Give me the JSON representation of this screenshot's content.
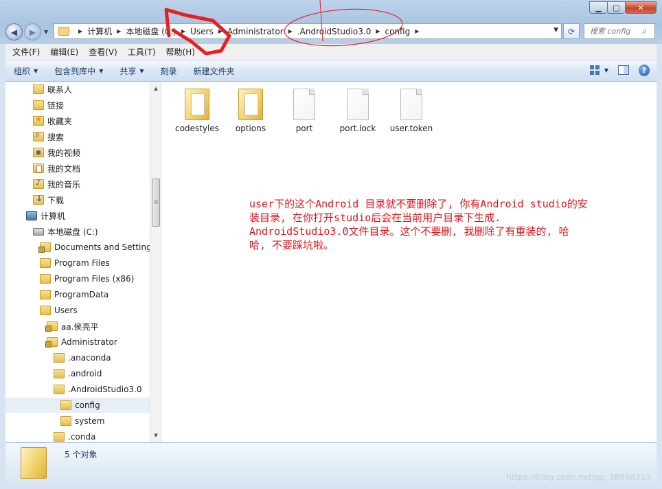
{
  "window": {
    "controls": {
      "minimize": "▁",
      "maximize": "□",
      "close": "✕"
    }
  },
  "nav": {
    "back_glyph": "◀",
    "forward_glyph": "▶"
  },
  "address": {
    "crumbs": [
      "计算机",
      "本地磁盘 (C:)",
      "Users",
      "Administrator",
      ".AndroidStudio3.0",
      "config"
    ]
  },
  "search": {
    "placeholder": "搜索 config"
  },
  "menu": [
    "文件(F)",
    "编辑(E)",
    "查看(V)",
    "工具(T)",
    "帮助(H)"
  ],
  "commands": {
    "organize": "组织",
    "include_in_library": "包含到库中",
    "share": "共享",
    "burn": "刻录",
    "new_folder": "新建文件夹"
  },
  "tree": [
    {
      "label": "联系人",
      "icon": "folder",
      "indent": 1
    },
    {
      "label": "链接",
      "icon": "folder",
      "indent": 1
    },
    {
      "label": "收藏夹",
      "icon": "star",
      "indent": 1
    },
    {
      "label": "搜索",
      "icon": "search",
      "indent": 1
    },
    {
      "label": "我的视频",
      "icon": "video",
      "indent": 1
    },
    {
      "label": "我的文档",
      "icon": "docs",
      "indent": 1
    },
    {
      "label": "我的音乐",
      "icon": "music",
      "indent": 1
    },
    {
      "label": "下载",
      "icon": "download",
      "indent": 1
    },
    {
      "label": "计算机",
      "icon": "computer",
      "indent": 0
    },
    {
      "label": "本地磁盘 (C:)",
      "icon": "drive",
      "indent": 1
    },
    {
      "label": "Documents and Settings",
      "icon": "folder-locked",
      "indent": 2
    },
    {
      "label": "Program Files",
      "icon": "folder",
      "indent": 2
    },
    {
      "label": "Program Files (x86)",
      "icon": "folder",
      "indent": 2
    },
    {
      "label": "ProgramData",
      "icon": "folder",
      "indent": 2
    },
    {
      "label": "Users",
      "icon": "folder",
      "indent": 2
    },
    {
      "label": "aa.侯亮平",
      "icon": "folder-locked",
      "indent": 3
    },
    {
      "label": "Administrator",
      "icon": "folder-locked",
      "indent": 3
    },
    {
      "label": ".anaconda",
      "icon": "folder",
      "indent": 4
    },
    {
      "label": ".android",
      "icon": "folder",
      "indent": 4
    },
    {
      "label": ".AndroidStudio3.0",
      "icon": "folder",
      "indent": 4
    },
    {
      "label": "config",
      "icon": "folder",
      "indent": 5,
      "selected": true
    },
    {
      "label": "system",
      "icon": "folder",
      "indent": 5
    },
    {
      "label": ".conda",
      "icon": "folder",
      "indent": 4
    }
  ],
  "files": [
    {
      "name": "codestyles",
      "type": "folder"
    },
    {
      "name": "options",
      "type": "folder"
    },
    {
      "name": "port",
      "type": "file"
    },
    {
      "name": "port.lock",
      "type": "file"
    },
    {
      "name": "user.token",
      "type": "file"
    }
  ],
  "annotation": {
    "lines": [
      "user下的这个Android 目录就不要删除了, 你有Android studio的安",
      "装目录, 在你打开studio后会在当前用户目录下生成.",
      "AndroidStudio3.0文件目录。这个不要删, 我删除了有重装的, 哈",
      "哈, 不要踩坑啦。"
    ],
    "color": "#e0141a"
  },
  "status": {
    "count_text": "5 个对象"
  },
  "watermark": "https://blog.csdn.net/qq_38998213",
  "accent_colors": {
    "selection": "#e8eef6",
    "chrome": "#b9cfe6"
  }
}
